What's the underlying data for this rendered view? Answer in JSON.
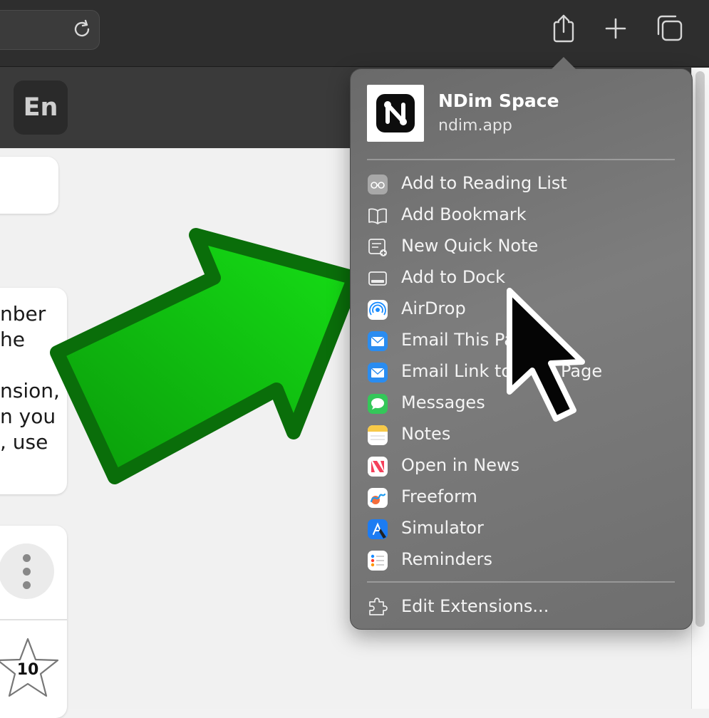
{
  "toolbar": {
    "reload_icon": "reload-icon",
    "share_icon": "share-icon",
    "new_tab_icon": "plus-icon",
    "tabs_icon": "tabs-overview-icon"
  },
  "language_button": {
    "label": "En"
  },
  "page": {
    "card_text": [
      "nber",
      "he",
      "",
      "nsion,",
      "n you",
      ", use"
    ],
    "star_count": "10"
  },
  "share_menu": {
    "site_name": "NDim Space",
    "site_url": "ndim.app",
    "items": [
      {
        "label": "Add to Reading List",
        "icon": "glasses-icon"
      },
      {
        "label": "Add Bookmark",
        "icon": "book-icon"
      },
      {
        "label": "New Quick Note",
        "icon": "quick-note-icon"
      },
      {
        "label": "Add to Dock",
        "icon": "dock-icon"
      },
      {
        "label": "AirDrop",
        "icon": "airdrop-icon"
      },
      {
        "label": "Email This Pa",
        "icon": "mail-icon"
      },
      {
        "label": "Email Link to",
        "icon": "mail-icon"
      },
      {
        "label": "Messages",
        "icon": "messages-icon"
      },
      {
        "label": "Notes",
        "icon": "notes-icon"
      },
      {
        "label": "Open in News",
        "icon": "news-icon"
      },
      {
        "label": "Freeform",
        "icon": "freeform-icon"
      },
      {
        "label": "Simulator",
        "icon": "simulator-icon"
      },
      {
        "label": "Reminders",
        "icon": "reminders-icon"
      }
    ],
    "page_suffix": "Page",
    "edit_extensions": {
      "label": "Edit Extensions...",
      "icon": "extensions-icon"
    }
  },
  "colors": {
    "arrow_fill": "#11c811",
    "arrow_stroke": "#0a6e0a",
    "popover_bg": "#767676",
    "toolbar_bg": "#2e2e2e"
  }
}
